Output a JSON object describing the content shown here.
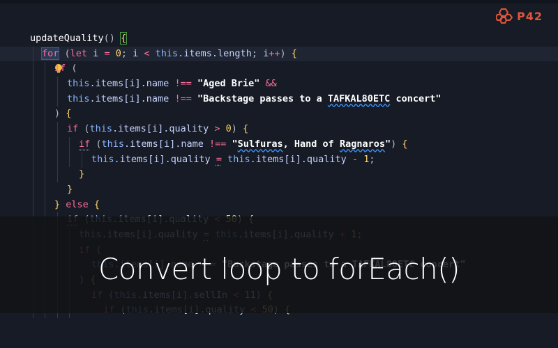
{
  "logo": {
    "text": "P42",
    "icon": "p42-logo-icon"
  },
  "caption": "Convert loop to forEach()",
  "code_lines": [
    "updateQuality() {",
    "for (let i = 0; i < this.items.length; i++) {",
    "if (",
    "this.items[i].name !== \"Aged Brie\" &&",
    "this.items[i].name !== \"Backstage passes to a TAFKAL80ETC concert\"",
    ") {",
    "if (this.items[i].quality > 0) {",
    "if (this.items[i].name !== \"Sulfuras, Hand of Ragnaros\") {",
    "this.items[i].quality = this.items[i].quality - 1;",
    "}",
    "}",
    "} else {",
    "if (this.items[i].quality < 50) {",
    "this.items[i].quality = this.items[i].quality + 1;",
    "if (",
    "this.items[i].name === \"Backstage passes to a TAFKAL80ETC concert\"",
    ") {",
    "if (this.items[i].sellIn < 11) {",
    "if (this.items[i].quality < 50) {"
  ],
  "colors": {
    "background": "#161b25",
    "keyword": "#ff6e9c",
    "string": "#ffffff",
    "number": "#ffd66a",
    "this": "#8ab4ff",
    "squiggle": "#3e95ff",
    "logo": "#e0563a"
  },
  "icons": {
    "lightbulb": "lightbulb-icon"
  }
}
